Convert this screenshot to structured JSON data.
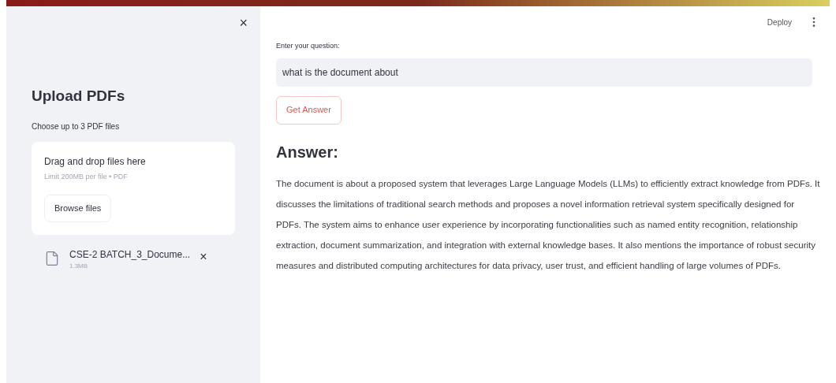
{
  "sidebar": {
    "close": "×",
    "title": "Upload PDFs",
    "uploader": {
      "label": "Choose up to 3 PDF files",
      "drop_text": "Drag and drop files here",
      "limit": "Limit 200MB per file • PDF",
      "browse_button": "Browse files"
    },
    "files": [
      {
        "name": "CSE-2 BATCH_3_Docume...",
        "size": "1.3MB",
        "remove": "×"
      }
    ]
  },
  "header": {
    "deploy": "Deploy"
  },
  "question": {
    "label": "Enter your question:",
    "value": "what is the document about"
  },
  "submit_button": "Get Answer",
  "answer": {
    "heading": "Answer:",
    "text": "The document is about a proposed system that leverages Large Language Models (LLMs) to efficiently extract knowledge from PDFs. It discusses the limitations of traditional search methods and proposes a novel information retrieval system specifically designed for PDFs. The system aims to enhance user experience by incorporating functionalities such as named entity recognition, relationship extraction, document summarization, and integration with external knowledge bases. It also mentions the importance of robust security measures and distributed computing architectures for data privacy, user trust, and efficient handling of large volumes of PDFs."
  }
}
